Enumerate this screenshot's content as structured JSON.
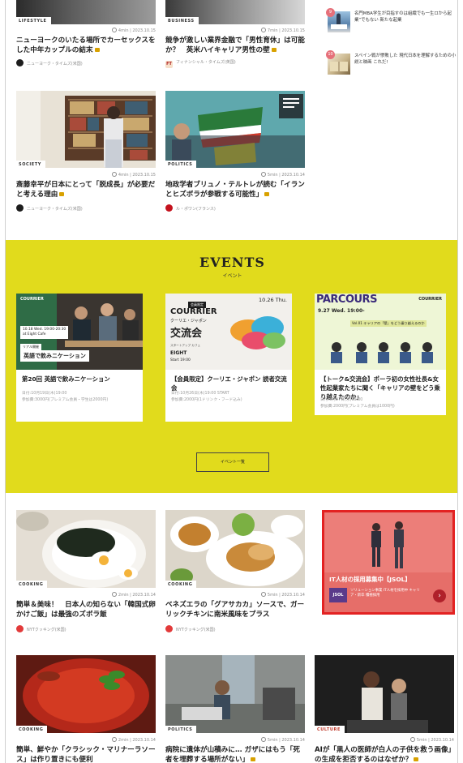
{
  "top_articles": [
    {
      "category": "LIFESTYLE",
      "meta": "4min | 2023.10.15",
      "title": "ニューヨークのいたる場所でカーセックスをした中年カップルの結末",
      "source": "ニューヨーク・タイムズ(米国)"
    },
    {
      "category": "BUSINESS",
      "meta": "7min | 2023.10.15",
      "title": "競争が激しい業界金融で「男性育休」は可能か？　英米ハイキャリア男性の壁",
      "source": "フィナンシャル・タイムズ(英国)",
      "source_logo": "FT"
    },
    {
      "category": "SOCIETY",
      "meta": "4min | 2023.10.15",
      "title": "斎藤幸平が日本にとって「脱成長」が必要だと考える理由",
      "source": "ニューヨーク・タイムズ(米国)"
    },
    {
      "category": "POLITICS",
      "meta": "5min | 2023.10.14",
      "title": "地政学者ブリュノ・テルトレが読む「イランとヒズボラが参戦する可能性」",
      "source": "ル・ポワン(フランス)"
    }
  ],
  "sidebar": [
    {
      "num": "9",
      "text": "名門MBA学生が目指すのは組織でも一生ロから起業”でもない 新たな起業"
    },
    {
      "num": "10",
      "text": "スペイン戦が惨敗した 現代日本を理解するための小説と映画 これだ!"
    }
  ],
  "events": {
    "heading": "EVENTS",
    "subheading": "イベント",
    "button_label": "イベント一覧",
    "cards": [
      {
        "title": "第20回 英語で飲みニケーション",
        "info1": "日付:10月19日(木)19:00",
        "info2": "参加費:3000円(プレミアム会員・学生は2000円)",
        "img_brand": "COURRIER",
        "img_date": "10.18 Wed. 19:00-20:30",
        "img_place": "at Eight Cafe",
        "img_label": "リアル開催",
        "img_caption": "英語で飲みニケーション"
      },
      {
        "title": "【会員限定】クーリエ・ジャポン 読者交流会",
        "info1": "日付:10月26日(木)19:00 START",
        "info2": "参加費:2000円(1ドリンク・フード込み)",
        "img_date": "10.26 Thu.",
        "img_badge": "会員限定",
        "img_brand": "COURRIER",
        "img_jp": "クーリエ・ジャポン",
        "img_big": "交流会",
        "img_venue_pre": "スタートアップ カフェ",
        "img_venue": "EIGHT",
        "img_start": "Start 19:00"
      },
      {
        "title": "【トーク&交流会】ポーラ初の女性社長&女性起業家たちに聞く「キャリアの壁をどう乗り越えたのか」",
        "info1": "日付:9月27日(水)19:00",
        "info2": "参加費:2000円(プレミアム会員は1000円)",
        "img_brand": "PARCOURS",
        "img_brand2": "COURRIER",
        "img_date": "9.27 Wed. 19:00-",
        "img_vol": "Vol.01 キャリアの「壁」をどう乗り越えるのか"
      }
    ]
  },
  "bottom_articles": [
    {
      "category": "COOKING",
      "meta": "2min | 2023.10.14",
      "title": "簡単＆美味！　日本人の知らない「韓国式卵かけご飯」は最強のズボラ飯",
      "source": "NYTクッキング(米国)"
    },
    {
      "category": "COOKING",
      "meta": "5min | 2023.10.14",
      "title": "ベネズエラの「グアサカカ」ソースで、ガーリックチキンに南米風味をプラス",
      "source": "NYTクッキング(米国)"
    },
    {
      "category": "COOKING",
      "meta": "2min | 2023.10.14",
      "title": "簡単、鮮やか「クラシック・マリナーラソース」は作り置きにも便利"
    },
    {
      "category": "POLITICS",
      "meta": "5min | 2023.10.14",
      "title": "病院に遺体が山積みに… ガザにはもう「死者を埋葬する場所がない」"
    },
    {
      "category": "CULTURE",
      "meta": "5min | 2023.10.14",
      "title": "AIが「黒人の医師が白人の子供を救う画像」の生成を拒否するのはなぜか？"
    }
  ],
  "ad": {
    "headline": "IT人材の採用募集中【JSOL】",
    "logo": "JSOL",
    "body": "ソリューション事業 IT人材を採用中 キャリア・新卒 積極採用",
    "accent": "#e32222",
    "bg": "#ed7a76"
  },
  "colors": {
    "events_bg": "#e1db1c",
    "lock": "#d8a100"
  }
}
